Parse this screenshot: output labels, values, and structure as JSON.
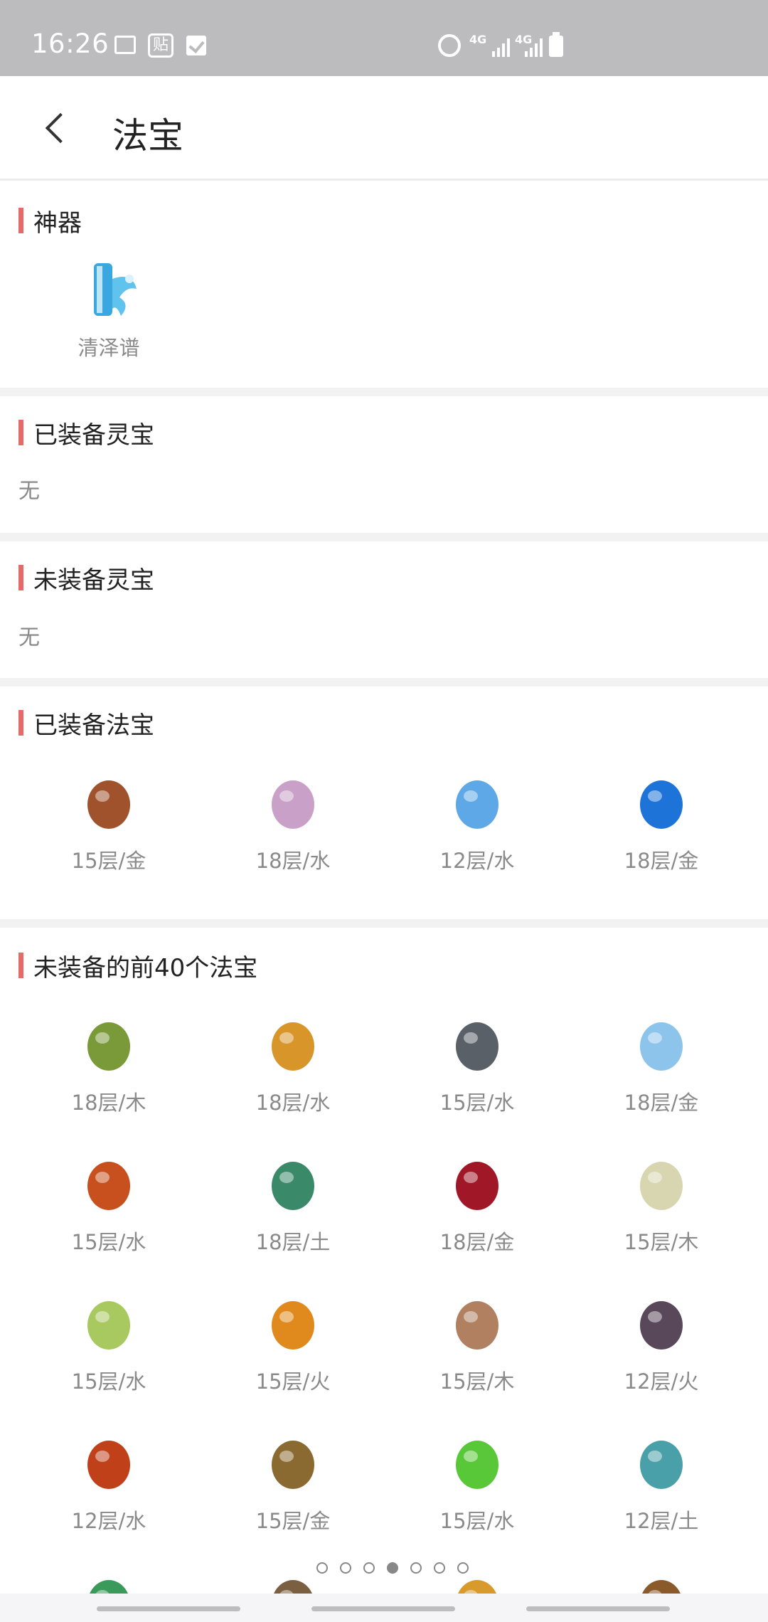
{
  "status_bar": {
    "time": "16:26",
    "left_icons": [
      "photo-icon",
      "tie-icon",
      "check-icon"
    ],
    "tie_glyph": "贴",
    "network_label_1": "4G",
    "network_label_2": "4G",
    "right_icons": [
      "alarm-icon",
      "signal-icon",
      "signal-icon",
      "battery-icon"
    ]
  },
  "header": {
    "back_icon": "chevron-left-icon",
    "title": "法宝"
  },
  "sections": {
    "artifact": {
      "title": "神器",
      "items": [
        {
          "label": "清泽谱",
          "icon": "scroll-icon",
          "color": "#3aa7e0"
        }
      ]
    },
    "equipped_spirit": {
      "title": "已装备灵宝",
      "empty": "无"
    },
    "unequipped_spirit": {
      "title": "未装备灵宝",
      "empty": "无"
    },
    "equipped_treasure": {
      "title": "已装备法宝",
      "items": [
        {
          "label": "15层/金",
          "icon": "chest-icon",
          "color": "#a0522d"
        },
        {
          "label": "18层/水",
          "icon": "flute-icon",
          "color": "#c9a0c8"
        },
        {
          "label": "12层/水",
          "icon": "stone-icon",
          "color": "#5ea8e8"
        },
        {
          "label": "18层/金",
          "icon": "orb-icon",
          "color": "#1e73d8"
        }
      ]
    },
    "unequipped_top40": {
      "title": "未装备的前40个法宝",
      "items": [
        {
          "label": "18层/木",
          "icon": "token-icon",
          "color": "#7a9a3a"
        },
        {
          "label": "18层/水",
          "icon": "dragon-ring-icon",
          "color": "#d8962a"
        },
        {
          "label": "15层/水",
          "icon": "lantern-icon",
          "color": "#5a6068"
        },
        {
          "label": "18层/金",
          "icon": "snail-icon",
          "color": "#8cc4ec"
        },
        {
          "label": "15层/水",
          "icon": "bell-icon",
          "color": "#c8501e"
        },
        {
          "label": "18层/土",
          "icon": "box-icon",
          "color": "#3a8a6a"
        },
        {
          "label": "18层/金",
          "icon": "flame-icon",
          "color": "#a01828"
        },
        {
          "label": "15层/木",
          "icon": "doll-icon",
          "color": "#d8d6b0"
        },
        {
          "label": "15层/水",
          "icon": "brush-icon",
          "color": "#a8c860"
        },
        {
          "label": "15层/火",
          "icon": "pagoda-icon",
          "color": "#e08a1e"
        },
        {
          "label": "15层/木",
          "icon": "monk-icon",
          "color": "#b08060"
        },
        {
          "label": "12层/火",
          "icon": "case-icon",
          "color": "#58485a"
        },
        {
          "label": "12层/水",
          "icon": "bell-icon",
          "color": "#c0401a"
        },
        {
          "label": "15层/金",
          "icon": "beads-icon",
          "color": "#8a6a30"
        },
        {
          "label": "15层/水",
          "icon": "jade-bar-icon",
          "color": "#58c838"
        },
        {
          "label": "12层/土",
          "icon": "gourd-icon",
          "color": "#4aa0a8"
        }
      ],
      "partial_row": [
        {
          "icon": "leaf-icon",
          "color": "#3a9a5a"
        },
        {
          "icon": "ring-icon",
          "color": "#7a6040"
        },
        {
          "icon": "shell-icon",
          "color": "#d89a2a"
        },
        {
          "icon": "pot-icon",
          "color": "#8a5a2a"
        }
      ]
    }
  },
  "pager": {
    "count": 7,
    "active_index": 3
  }
}
